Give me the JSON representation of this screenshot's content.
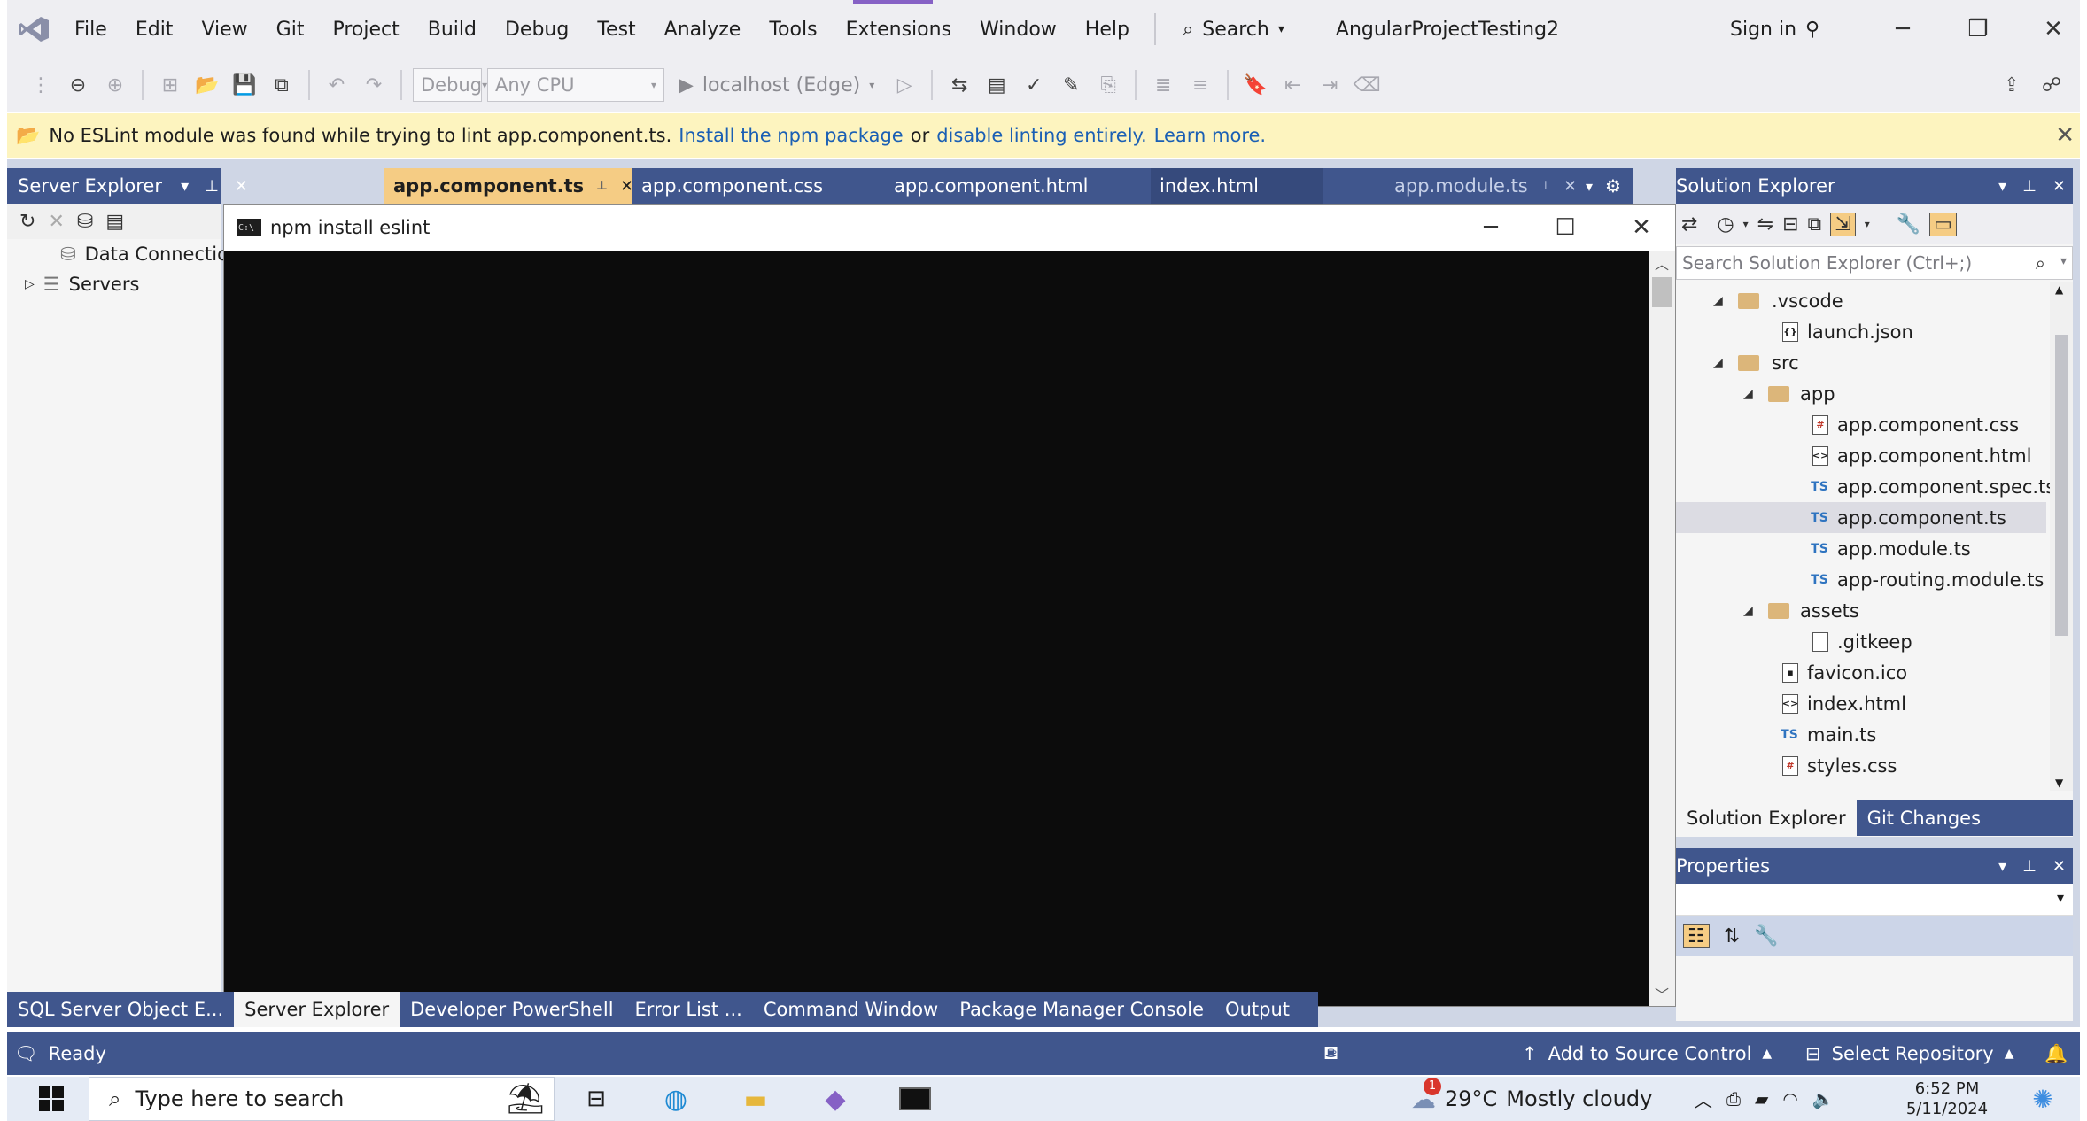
{
  "menubar": {
    "items": [
      "File",
      "Edit",
      "View",
      "Git",
      "Project",
      "Build",
      "Debug",
      "Test",
      "Analyze",
      "Tools",
      "Extensions",
      "Window",
      "Help"
    ],
    "search_label": "Search",
    "project_title": "AngularProjectTesting2",
    "signin_label": "Sign in"
  },
  "toolbar": {
    "config_value": "Debug",
    "platform_value": "Any CPU",
    "run_target": "localhost (Edge)"
  },
  "infobar": {
    "message": "No ESLint module was found while trying to lint app.component.ts.",
    "link_install": "Install the npm package",
    "or_text": "or",
    "link_disable": "disable linting entirely.",
    "link_learn": "Learn more."
  },
  "server_explorer": {
    "title": "Server Explorer",
    "items": [
      "Data Connectio",
      "Servers"
    ]
  },
  "editor_tabs": [
    {
      "label": "app.component.ts",
      "active": true
    },
    {
      "label": "app.component.css",
      "active": false
    },
    {
      "label": "app.component.html",
      "active": false
    },
    {
      "label": "index.html",
      "active": false
    },
    {
      "label": "app.module.ts",
      "active": false
    }
  ],
  "console": {
    "title": "npm install eslint",
    "icon_text": "C:\\"
  },
  "solution_explorer": {
    "title": "Solution Explorer",
    "search_placeholder": "Search Solution Explorer (Ctrl+;)",
    "tree": [
      {
        "label": ".vscode",
        "kind": "folder"
      },
      {
        "label": "launch.json",
        "kind": "json"
      },
      {
        "label": "src",
        "kind": "folder"
      },
      {
        "label": "app",
        "kind": "folder"
      },
      {
        "label": "app.component.css",
        "kind": "css"
      },
      {
        "label": "app.component.html",
        "kind": "html"
      },
      {
        "label": "app.component.spec.ts",
        "kind": "ts"
      },
      {
        "label": "app.component.ts",
        "kind": "ts"
      },
      {
        "label": "app.module.ts",
        "kind": "ts"
      },
      {
        "label": "app-routing.module.ts",
        "kind": "ts"
      },
      {
        "label": "assets",
        "kind": "folder"
      },
      {
        "label": ".gitkeep",
        "kind": "file"
      },
      {
        "label": "favicon.ico",
        "kind": "ico"
      },
      {
        "label": "index.html",
        "kind": "html"
      },
      {
        "label": "main.ts",
        "kind": "ts"
      },
      {
        "label": "styles.css",
        "kind": "css"
      }
    ],
    "bottom_tabs": [
      "Solution Explorer",
      "Git Changes"
    ]
  },
  "properties": {
    "title": "Properties"
  },
  "bottom_tool_tabs": [
    "SQL Server Object E...",
    "Server Explorer",
    "Developer PowerShell",
    "Error List ...",
    "Command Window",
    "Package Manager Console",
    "Output"
  ],
  "statusbar": {
    "status": "Ready",
    "source_control": "Add to Source Control",
    "repository": "Select Repository"
  },
  "taskbar": {
    "search_placeholder": "Type here to search",
    "temperature": "29°C",
    "weather": "Mostly cloudy",
    "time": "6:52 PM",
    "date": "5/11/2024",
    "notification_count": "1"
  },
  "colors": {
    "chrome": "#eeeef2",
    "panel_header": "#40568d",
    "active_tab": "#f5cc84",
    "infobar": "#fdf4bf",
    "console_bg": "#0c0c0c",
    "link": "#1a5fb4"
  }
}
